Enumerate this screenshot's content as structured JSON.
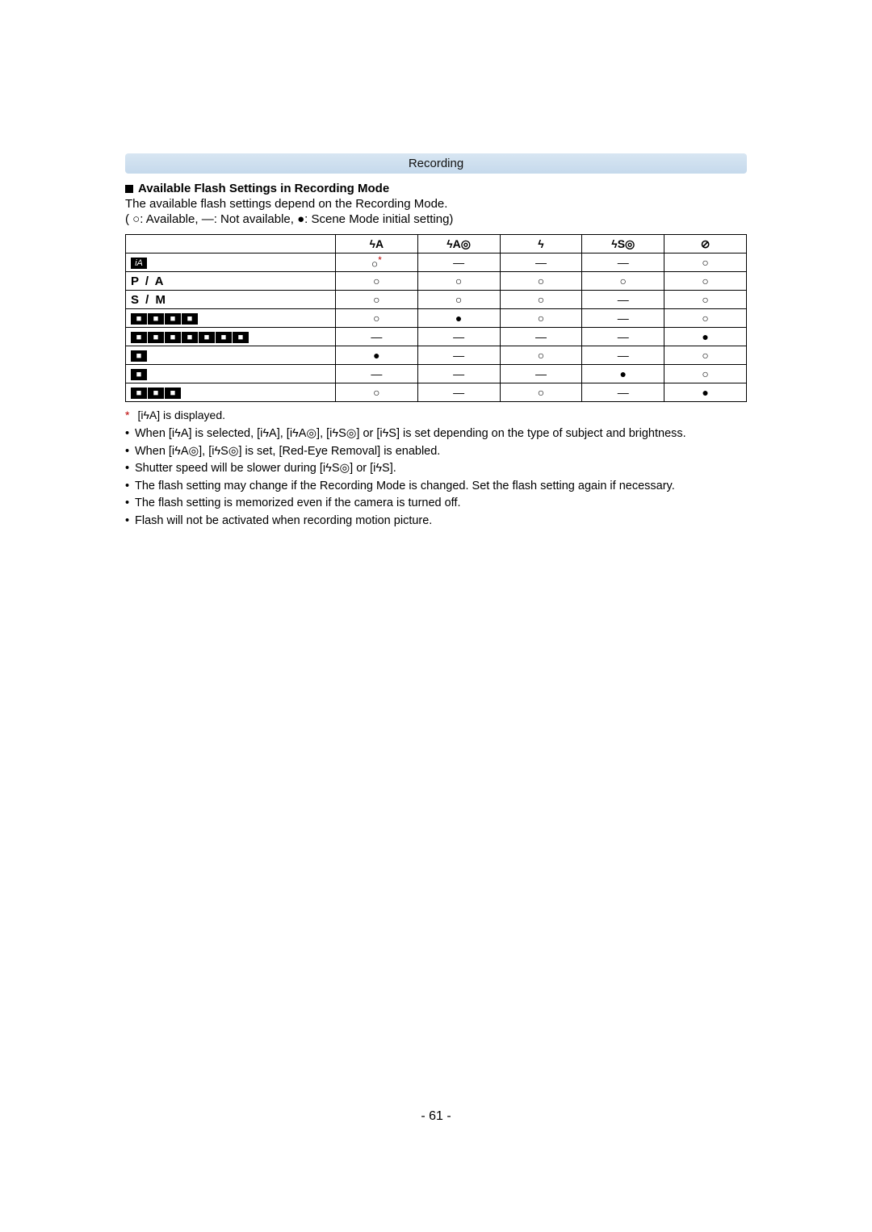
{
  "header": {
    "section": "Recording"
  },
  "heading": "Available Flash Settings in Recording Mode",
  "intro": "The available flash settings depend on the Recording Mode.",
  "legend_prefix": "(",
  "legend_avail": "○:  Available,",
  "legend_na": "—:  Not available,",
  "legend_init": "●:  Scene Mode initial setting)",
  "columns": {
    "c1": "ϟA",
    "c2": "ϟA◎",
    "c3": "ϟ",
    "c4": "ϟS◎",
    "c5": "⊘"
  },
  "rows": [
    {
      "label_type": "icon",
      "icons": [
        "iA"
      ],
      "cells": [
        "○*",
        "—",
        "—",
        "—",
        "○"
      ]
    },
    {
      "label_type": "text",
      "text": "P  /  A",
      "cells": [
        "○",
        "○",
        "○",
        "○",
        "○"
      ]
    },
    {
      "label_type": "text",
      "text": "S  /  M",
      "cells": [
        "○",
        "○",
        "○",
        "—",
        "○"
      ]
    },
    {
      "label_type": "icon",
      "icons": [
        "P1",
        "P2",
        "B1",
        "B2"
      ],
      "cells": [
        "○",
        "●",
        "○",
        "—",
        "○"
      ]
    },
    {
      "label_type": "icon",
      "icons": [
        "L1",
        "L2",
        "L3",
        "L4",
        "L5",
        "L6",
        "L7"
      ],
      "cells": [
        "—",
        "—",
        "—",
        "—",
        "●"
      ]
    },
    {
      "label_type": "icon",
      "icons": [
        "SP"
      ],
      "cells": [
        "●",
        "—",
        "○",
        "—",
        "○"
      ]
    },
    {
      "label_type": "icon",
      "icons": [
        "ST"
      ],
      "cells": [
        "—",
        "—",
        "—",
        "●",
        "○"
      ]
    },
    {
      "label_type": "icon",
      "icons": [
        "D1",
        "D2",
        "D3"
      ],
      "cells": [
        "○",
        "—",
        "○",
        "—",
        "●"
      ]
    }
  ],
  "footnote_marker": "*",
  "footnote_text": "[iϟA] is displayed.",
  "notes": [
    "When [iϟA] is selected, [iϟA], [iϟA◎], [iϟS◎] or [iϟS] is set depending on the type of subject and brightness.",
    "When [iϟA◎], [iϟS◎] is set, [Red-Eye Removal] is enabled.",
    "Shutter speed will be slower during [iϟS◎] or [iϟS].",
    "The flash setting may change if the Recording Mode is changed. Set the flash setting again if necessary.",
    "The flash setting is memorized even if the camera is turned off.",
    "Flash will not be activated when recording motion picture."
  ],
  "page_number": "- 61 -"
}
